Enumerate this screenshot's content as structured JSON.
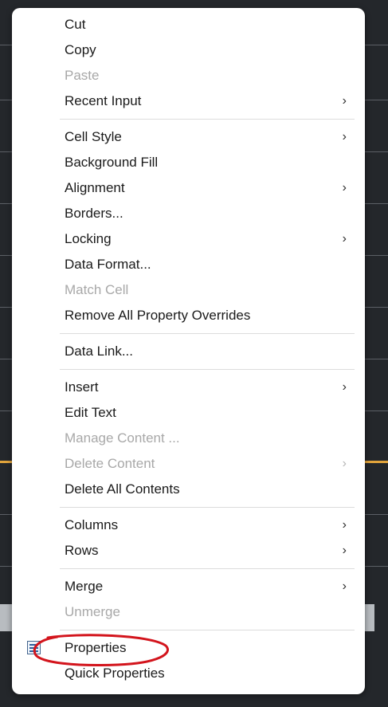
{
  "context_menu": {
    "groups": [
      [
        {
          "label": "Cut",
          "enabled": true,
          "submenu": false
        },
        {
          "label": "Copy",
          "enabled": true,
          "submenu": false
        },
        {
          "label": "Paste",
          "enabled": false,
          "submenu": false
        },
        {
          "label": "Recent Input",
          "enabled": true,
          "submenu": true
        }
      ],
      [
        {
          "label": "Cell Style",
          "enabled": true,
          "submenu": true
        },
        {
          "label": "Background Fill",
          "enabled": true,
          "submenu": false
        },
        {
          "label": "Alignment",
          "enabled": true,
          "submenu": true
        },
        {
          "label": "Borders...",
          "enabled": true,
          "submenu": false
        },
        {
          "label": "Locking",
          "enabled": true,
          "submenu": true
        },
        {
          "label": "Data Format...",
          "enabled": true,
          "submenu": false
        },
        {
          "label": "Match Cell",
          "enabled": false,
          "submenu": false
        },
        {
          "label": "Remove All Property Overrides",
          "enabled": true,
          "submenu": false
        }
      ],
      [
        {
          "label": "Data Link...",
          "enabled": true,
          "submenu": false
        }
      ],
      [
        {
          "label": "Insert",
          "enabled": true,
          "submenu": true
        },
        {
          "label": "Edit Text",
          "enabled": true,
          "submenu": false
        },
        {
          "label": "Manage Content ...",
          "enabled": false,
          "submenu": false
        },
        {
          "label": "Delete Content",
          "enabled": false,
          "submenu": true
        },
        {
          "label": "Delete All Contents",
          "enabled": true,
          "submenu": false
        }
      ],
      [
        {
          "label": "Columns",
          "enabled": true,
          "submenu": true
        },
        {
          "label": "Rows",
          "enabled": true,
          "submenu": true
        }
      ],
      [
        {
          "label": "Merge",
          "enabled": true,
          "submenu": true
        },
        {
          "label": "Unmerge",
          "enabled": false,
          "submenu": false
        }
      ],
      [
        {
          "label": "Properties",
          "enabled": true,
          "submenu": false,
          "icon": "properties-icon",
          "highlighted_by_annotation": true
        },
        {
          "label": "Quick Properties",
          "enabled": true,
          "submenu": false
        }
      ]
    ],
    "submenu_glyph": "›"
  },
  "colors": {
    "menu_background": "#ffffff",
    "text_enabled": "#1a1a1a",
    "text_disabled": "#a8a8a8",
    "annotation_circle": "#d3141c"
  }
}
